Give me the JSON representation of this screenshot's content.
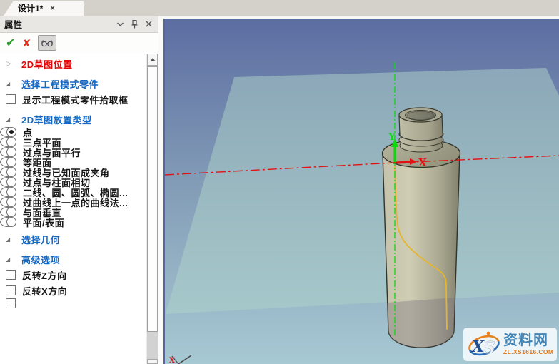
{
  "tab_bar": {
    "active_tab": "设计1*",
    "close_glyph": "×"
  },
  "panel": {
    "title": "属性",
    "toolbar": {
      "ok_icon": "green-check",
      "cancel_icon": "red-x",
      "glasses_icon": "eyeglasses"
    },
    "rows": [
      {
        "name": "section-2d-sketch-location",
        "type": "group",
        "color": "red",
        "label": "2D草图位置",
        "expanded": false
      },
      {
        "name": "section-select-engineering-part",
        "type": "group",
        "color": "blue",
        "label": "选择工程模式零件",
        "expanded": true,
        "gap": true
      },
      {
        "name": "checkbox-show-engineering-part-pickbox",
        "type": "checkbox",
        "label": "显示工程模式零件拾取框",
        "checked": false
      },
      {
        "name": "section-2d-sketch-placement-type",
        "type": "group",
        "color": "blue",
        "label": "2D草图放置类型",
        "expanded": true,
        "gap": true
      },
      {
        "name": "radio-point",
        "type": "radio",
        "label": "点",
        "selected": true
      },
      {
        "name": "radio-three-point-plane",
        "type": "radio",
        "label": "三点平面",
        "selected": false
      },
      {
        "name": "radio-through-point-parallel-face",
        "type": "radio",
        "label": "过点与面平行",
        "selected": false
      },
      {
        "name": "radio-offset-face",
        "type": "radio",
        "label": "等距面",
        "selected": false
      },
      {
        "name": "radio-line-angle-to-known-face",
        "type": "radio",
        "label": "过线与已知面成夹角",
        "selected": false
      },
      {
        "name": "radio-point-tangent-cylinder",
        "type": "radio",
        "label": "过点与柱面相切",
        "selected": false
      },
      {
        "name": "radio-two-lines-circle-arc-ellipse",
        "type": "radio",
        "label": "二线、圆、圆弧、椭圆...",
        "selected": false
      },
      {
        "name": "radio-curve-normal-at-point",
        "type": "radio",
        "label": "过曲线上一点的曲线法...",
        "selected": false
      },
      {
        "name": "radio-perpendicular-to-face",
        "type": "radio",
        "label": "与面垂直",
        "selected": false
      },
      {
        "name": "radio-plane-surface",
        "type": "radio",
        "label": "平面/表面",
        "selected": false
      },
      {
        "name": "section-select-geometry",
        "type": "group",
        "color": "blue",
        "label": "选择几何",
        "expanded": true,
        "gap": true
      },
      {
        "name": "section-advanced-options",
        "type": "group",
        "color": "blue",
        "label": "高级选项",
        "expanded": true,
        "gap": true
      },
      {
        "name": "checkbox-flip-z-direction",
        "type": "checkbox",
        "label": "反转Z方向",
        "checked": false
      },
      {
        "name": "checkbox-flip-x-direction",
        "type": "checkbox",
        "label": "反转X方向",
        "checked": false
      }
    ]
  },
  "viewport": {
    "x_axis_label": "X",
    "y_axis_label": "Y",
    "triad_x_label": "X",
    "colors": {
      "axis_x": "#e31212",
      "axis_y": "#0ed80e",
      "sketch_curve": "#e6b52c",
      "plane_tint": "#aecfc8",
      "bottle_tan": "#b2b098",
      "background_top": "#5c6da2",
      "background_bottom": "#a7c9d3"
    }
  },
  "watermark": {
    "logo_text": "XS",
    "site_name": "资料网",
    "site_url": "ZL.XS1616.COM"
  }
}
